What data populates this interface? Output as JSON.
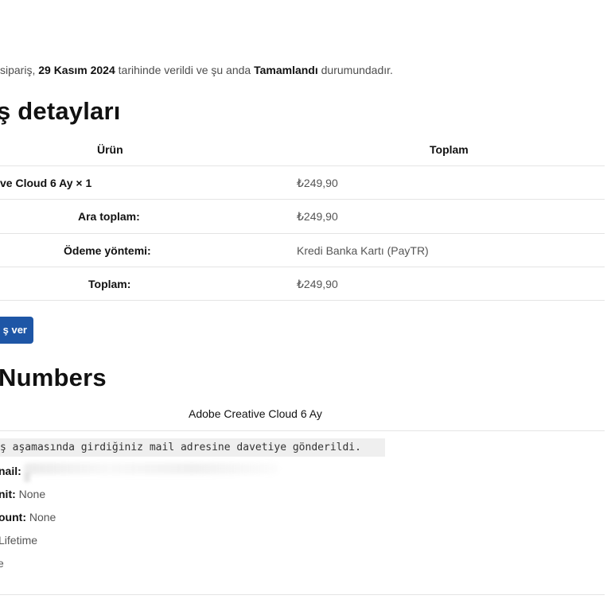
{
  "order_status": {
    "prefix": "siparis̀, ",
    "text_1": " sipariş, ",
    "date": "29 Kasım 2024",
    "text_2": " tarihinde verildi ve şu anda ",
    "status": "Tamamlandı",
    "text_3": " durumundadır."
  },
  "order_details": {
    "heading": "ş detayları",
    "columns": [
      "Ürün",
      "Toplam"
    ],
    "product_row": {
      "product": "ve Cloud 6 Ay × 1",
      "total": "₺249,90"
    },
    "summary": [
      {
        "label": "Ara toplam:",
        "value": "₺249,90"
      },
      {
        "label": "Ödeme yöntemi:",
        "value": "Kredi Banka Kartı (PayTR)"
      },
      {
        "label": "Toplam:",
        "value": "₺249,90"
      }
    ],
    "reorder_button": "ş ver"
  },
  "numbers": {
    "heading": "Numbers",
    "product_header": "Adobe Creative Cloud 6 Ay",
    "notice": "ş aşamasında girdiğiniz mail adresine davetiye gönderildi.",
    "fields": [
      {
        "label": "nail:",
        "value": ""
      },
      {
        "label": "nit:",
        "value": "None"
      },
      {
        "label": "ount:",
        "value": "None"
      },
      {
        "label": "",
        "value": "Lifetime"
      },
      {
        "label": "",
        "value": "e"
      }
    ]
  }
}
